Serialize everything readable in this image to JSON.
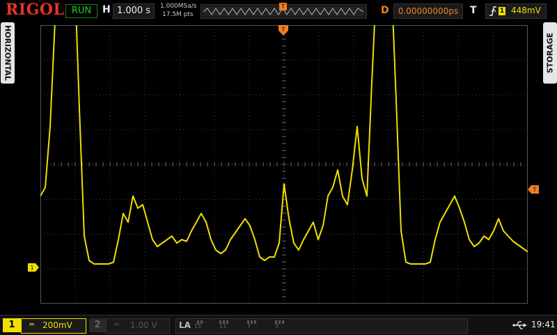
{
  "header": {
    "brand": "RIGOL",
    "run_status": "RUN",
    "horizontal_label": "H",
    "timebase": "1.000 s",
    "sample_rate": "1.000MSa/s",
    "memory_depth": "17.5M pts",
    "trigger_marker": "T",
    "delay_label": "D",
    "delay_value": "0.00000000ps",
    "trigger_label": "T",
    "trigger_edge": "rising-edge-icon",
    "trigger_source": "1",
    "trigger_level": "448mV"
  },
  "side_menu": {
    "left_tab": "HORIZONTAL",
    "right_tab": "STORAGE"
  },
  "markers": {
    "ch1_offset": "1",
    "trigger_level": "T"
  },
  "footer": {
    "ch1_label": "1",
    "ch1_coupling": "=",
    "ch1_scale": "200mV",
    "ch2_label": "2",
    "ch2_coupling": "=",
    "ch2_scale": "1.00 V",
    "la_label": "LA",
    "la_channels": [
      "15",
      "11",
      "7",
      "3"
    ],
    "time": "19:41"
  },
  "colors": {
    "ch1": "#f0e000",
    "trigger": "#f08020",
    "run": "#1ed21e",
    "brand": "#e8322b"
  },
  "waveform": {
    "channel": "1",
    "samples": [
      [
        0,
        0.05
      ],
      [
        1,
        0.1
      ],
      [
        2,
        0.45
      ],
      [
        3,
        1.05
      ],
      [
        4,
        1.8
      ],
      [
        5,
        2.05
      ],
      [
        6,
        1.9
      ],
      [
        7,
        1.35
      ],
      [
        8,
        0.55
      ],
      [
        9,
        -0.18
      ],
      [
        10,
        -0.32
      ],
      [
        11,
        -0.34
      ],
      [
        12,
        -0.34
      ],
      [
        13,
        -0.34
      ],
      [
        14,
        -0.34
      ],
      [
        15,
        -0.33
      ],
      [
        16,
        -0.2
      ],
      [
        17,
        -0.05
      ],
      [
        18,
        -0.1
      ],
      [
        19,
        0.05
      ],
      [
        20,
        -0.02
      ],
      [
        21,
        0.0
      ],
      [
        22,
        -0.1
      ],
      [
        23,
        -0.2
      ],
      [
        24,
        -0.24
      ],
      [
        25,
        -0.22
      ],
      [
        26,
        -0.2
      ],
      [
        27,
        -0.18
      ],
      [
        28,
        -0.22
      ],
      [
        29,
        -0.2
      ],
      [
        30,
        -0.21
      ],
      [
        31,
        -0.15
      ],
      [
        32,
        -0.1
      ],
      [
        33,
        -0.05
      ],
      [
        34,
        -0.1
      ],
      [
        35,
        -0.2
      ],
      [
        36,
        -0.26
      ],
      [
        37,
        -0.28
      ],
      [
        38,
        -0.26
      ],
      [
        39,
        -0.2
      ],
      [
        40,
        -0.16
      ],
      [
        41,
        -0.12
      ],
      [
        42,
        -0.08
      ],
      [
        43,
        -0.12
      ],
      [
        44,
        -0.2
      ],
      [
        45,
        -0.3
      ],
      [
        46,
        -0.32
      ],
      [
        47,
        -0.3
      ],
      [
        48,
        -0.3
      ],
      [
        49,
        -0.22
      ],
      [
        50,
        0.12
      ],
      [
        51,
        -0.08
      ],
      [
        52,
        -0.22
      ],
      [
        53,
        -0.26
      ],
      [
        54,
        -0.2
      ],
      [
        55,
        -0.15
      ],
      [
        56,
        -0.1
      ],
      [
        57,
        -0.2
      ],
      [
        58,
        -0.12
      ],
      [
        59,
        0.05
      ],
      [
        60,
        0.1
      ],
      [
        61,
        0.2
      ],
      [
        62,
        0.05
      ],
      [
        63,
        0.0
      ],
      [
        64,
        0.2
      ],
      [
        65,
        0.45
      ],
      [
        66,
        0.15
      ],
      [
        67,
        0.05
      ],
      [
        68,
        0.7
      ],
      [
        69,
        1.3
      ],
      [
        70,
        2.05
      ],
      [
        71,
        1.9
      ],
      [
        72,
        1.3
      ],
      [
        73,
        0.6
      ],
      [
        74,
        -0.15
      ],
      [
        75,
        -0.33
      ],
      [
        76,
        -0.34
      ],
      [
        77,
        -0.34
      ],
      [
        78,
        -0.34
      ],
      [
        79,
        -0.34
      ],
      [
        80,
        -0.33
      ],
      [
        81,
        -0.2
      ],
      [
        82,
        -0.1
      ],
      [
        83,
        -0.05
      ],
      [
        84,
        0.0
      ],
      [
        85,
        0.05
      ],
      [
        86,
        -0.02
      ],
      [
        87,
        -0.1
      ],
      [
        88,
        -0.2
      ],
      [
        89,
        -0.24
      ],
      [
        90,
        -0.22
      ],
      [
        91,
        -0.18
      ],
      [
        92,
        -0.2
      ],
      [
        93,
        -0.15
      ],
      [
        94,
        -0.08
      ],
      [
        95,
        -0.15
      ],
      [
        96,
        -0.18
      ],
      [
        97,
        -0.21
      ],
      [
        98,
        -0.23
      ],
      [
        99,
        -0.25
      ],
      [
        100,
        -0.27
      ]
    ]
  }
}
